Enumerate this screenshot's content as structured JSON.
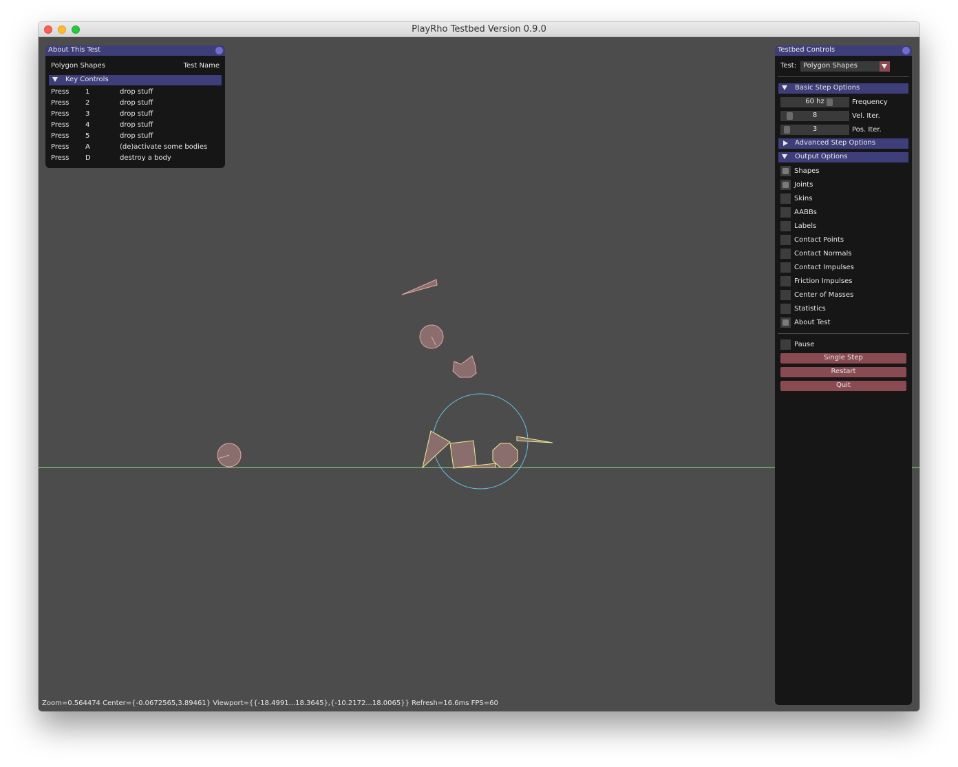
{
  "window": {
    "title": "PlayRho Testbed Version 0.9.0"
  },
  "about": {
    "title": "About This Test",
    "test_name": "Polygon Shapes",
    "test_name_label": "Test Name",
    "key_controls_label": "Key Controls",
    "keys": [
      {
        "action": "Press",
        "key": "1",
        "desc": "drop stuff"
      },
      {
        "action": "Press",
        "key": "2",
        "desc": "drop stuff"
      },
      {
        "action": "Press",
        "key": "3",
        "desc": "drop stuff"
      },
      {
        "action": "Press",
        "key": "4",
        "desc": "drop stuff"
      },
      {
        "action": "Press",
        "key": "5",
        "desc": "drop stuff"
      },
      {
        "action": "Press",
        "key": "A",
        "desc": "(de)activate some bodies"
      },
      {
        "action": "Press",
        "key": "D",
        "desc": "destroy a body"
      }
    ]
  },
  "controls": {
    "title": "Testbed Controls",
    "test_label": "Test:",
    "test_value": "Polygon Shapes",
    "basic_step_label": "Basic Step Options",
    "frequency": {
      "value": "60 hz",
      "label": "Frequency"
    },
    "vel_iter": {
      "value": "8",
      "label": "Vel. Iter."
    },
    "pos_iter": {
      "value": "3",
      "label": "Pos. Iter."
    },
    "advanced_step_label": "Advanced Step Options",
    "output_label": "Output Options",
    "outputs": [
      {
        "label": "Shapes",
        "checked": true
      },
      {
        "label": "Joints",
        "checked": true
      },
      {
        "label": "Skins",
        "checked": false
      },
      {
        "label": "AABBs",
        "checked": false
      },
      {
        "label": "Labels",
        "checked": false
      },
      {
        "label": "Contact Points",
        "checked": false
      },
      {
        "label": "Contact Normals",
        "checked": false
      },
      {
        "label": "Contact Impulses",
        "checked": false
      },
      {
        "label": "Friction Impulses",
        "checked": false
      },
      {
        "label": "Center of Masses",
        "checked": false
      },
      {
        "label": "Statistics",
        "checked": false
      },
      {
        "label": "About Test",
        "checked": true
      }
    ],
    "pause_label": "Pause",
    "single_step_label": "Single Step",
    "restart_label": "Restart",
    "quit_label": "Quit"
  },
  "status": "Zoom=0.564474 Center={-0.0672565,3.89461} Viewport={{-18.4991...18.3645},{-10.2172...18.0065}} Refresh=16.6ms FPS=60",
  "colors": {
    "background": "#4c4c4c",
    "ground": "#88e888",
    "static_body": "#e8a8a8",
    "awake_body": "#f0f090",
    "fill": "#8a6e6e",
    "query_circle": "#66c0e8",
    "panel_header": "#3e3e7a",
    "button": "#8a4a52"
  }
}
